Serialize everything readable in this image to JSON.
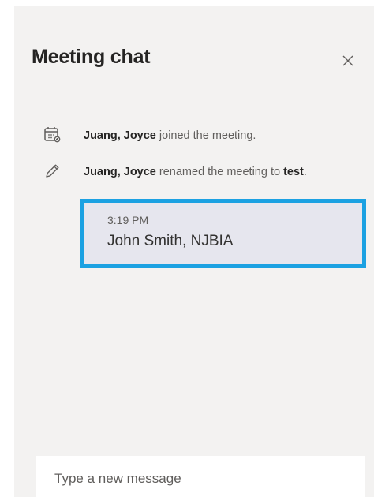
{
  "header": {
    "title": "Meeting chat",
    "close_icon": "close-icon"
  },
  "events": [
    {
      "icon": "calendar-join-icon",
      "name": "Juang, Joyce",
      "text": " joined the meeting."
    },
    {
      "icon": "pencil-icon",
      "name": "Juang, Joyce",
      "text": " renamed the meeting to ",
      "target": "test",
      "end": "."
    }
  ],
  "message": {
    "time": "3:19 PM",
    "author": "John Smith, NJBIA"
  },
  "compose": {
    "placeholder": "Type a new message"
  },
  "colors": {
    "highlight_border": "#1ba1e2",
    "panel_background": "#f3f2f1",
    "message_background": "#e6e6ee"
  }
}
